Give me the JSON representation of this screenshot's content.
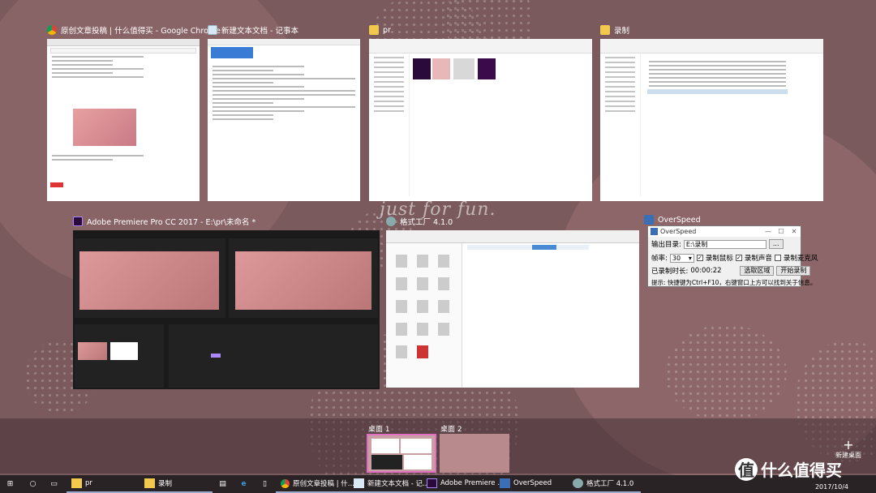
{
  "windows": {
    "chrome": {
      "title": "原创文章投稿 | 什么值得买 - Google Chrome",
      "icon": "chrome-icon"
    },
    "notepad": {
      "title": "新建文本文档 - 记事本",
      "icon": "notepad-icon"
    },
    "explorer_pr": {
      "title": "pr",
      "icon": "folder-icon"
    },
    "explorer_rec": {
      "title": "录制",
      "icon": "folder-icon"
    },
    "premiere": {
      "title": "Adobe Premiere Pro CC 2017 - E:\\pr\\未命名 *",
      "icon": "premiere-icon"
    },
    "formatfactory": {
      "title": "格式工厂 4.1.0",
      "icon": "formatfactory-icon"
    },
    "overspeed": {
      "title": "OverSpeed",
      "icon": "overspeed-icon"
    }
  },
  "overspeed": {
    "title": "OverSpeed",
    "output_label": "输出目录:",
    "output_value": "E:\\录制",
    "browse_label": "...",
    "fps_label": "帧率:",
    "fps_value": "30",
    "rec_cursor_label": "录制鼠标",
    "rec_audio_label": "录制声音",
    "rec_mic_label": "录制麦克风",
    "elapsed_label": "已录制时长:",
    "elapsed_value": "00:00:22",
    "select_area_label": "选取区域",
    "start_label": "开始录制",
    "tip": "提示: 快捷键为Ctrl+F10，右键窗口上方可以找到关于信息。"
  },
  "background": {
    "script_text": "just for fun."
  },
  "desktops": [
    {
      "label": "桌面 1",
      "active": true
    },
    {
      "label": "桌面 2",
      "active": false
    }
  ],
  "new_desktop_label": "新建桌面",
  "taskbar": {
    "items": [
      {
        "label": "pr",
        "icon": "folder-icon"
      },
      {
        "label": "录制",
        "icon": "folder-icon"
      },
      {
        "label": "原创文章投稿 | 什...",
        "icon": "chrome-icon"
      },
      {
        "label": "新建文本文档 - 记...",
        "icon": "notepad-icon"
      },
      {
        "label": "Adobe Premiere ...",
        "icon": "premiere-icon"
      },
      {
        "label": "OverSpeed",
        "icon": "overspeed-icon"
      },
      {
        "label": "格式工厂 4.1.0",
        "icon": "formatfactory-icon"
      }
    ],
    "date": "2017/10/4"
  },
  "watermark": {
    "text": "什么值得买",
    "logo": "值"
  }
}
